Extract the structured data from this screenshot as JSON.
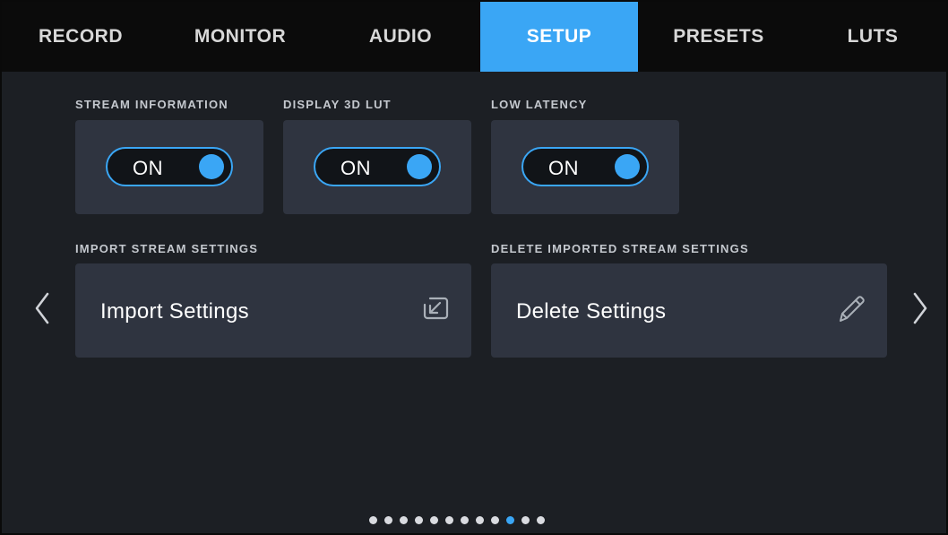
{
  "tabs": [
    {
      "label": "RECORD",
      "active": false
    },
    {
      "label": "MONITOR",
      "active": false
    },
    {
      "label": "AUDIO",
      "active": false
    },
    {
      "label": "SETUP",
      "active": true
    },
    {
      "label": "PRESETS",
      "active": false
    },
    {
      "label": "LUTS",
      "active": false
    }
  ],
  "settings": {
    "stream_information": {
      "label": "STREAM INFORMATION",
      "value": "ON"
    },
    "display_3d_lut": {
      "label": "DISPLAY 3D LUT",
      "value": "ON"
    },
    "low_latency": {
      "label": "LOW LATENCY",
      "value": "ON"
    },
    "import_stream_settings": {
      "label": "IMPORT STREAM SETTINGS",
      "button": "Import Settings",
      "icon": "import-icon"
    },
    "delete_imported_stream_settings": {
      "label": "DELETE IMPORTED STREAM SETTINGS",
      "button": "Delete Settings",
      "icon": "pencil-icon"
    }
  },
  "nav": {
    "prev_icon": "chevron-left-icon",
    "next_icon": "chevron-right-icon"
  },
  "pagination": {
    "total": 12,
    "current": 10
  },
  "colors": {
    "accent": "#3aa6f5",
    "background": "#1c1f24",
    "card": "#2f3440",
    "tabbar": "#0b0b0b"
  }
}
